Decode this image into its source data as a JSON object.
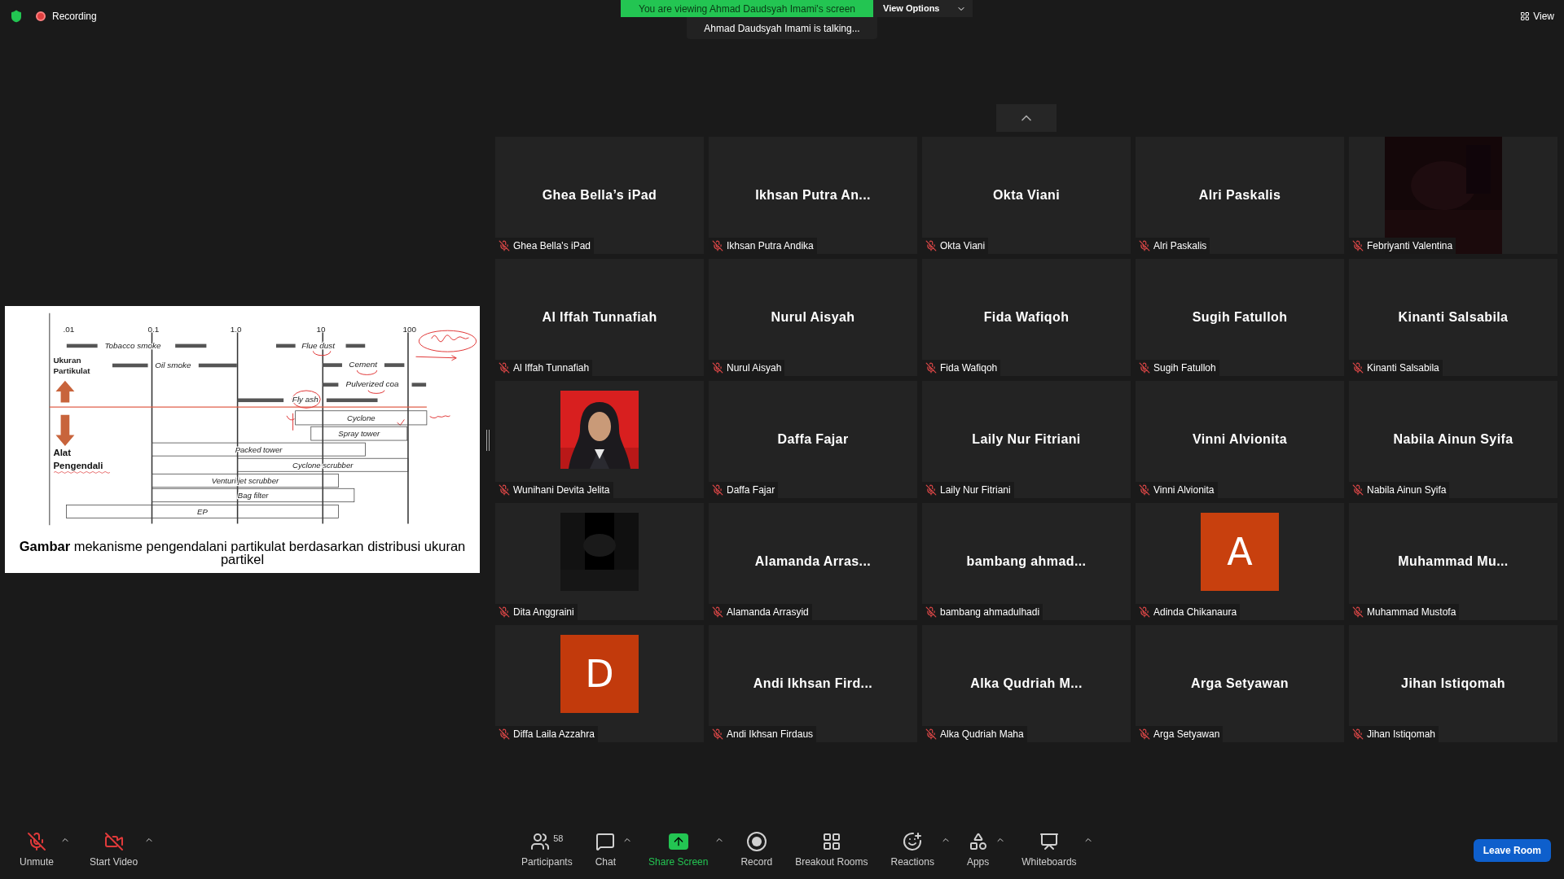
{
  "top_bar": {
    "recording": "Recording",
    "view": "View",
    "banner": "You are viewing Ahmad Daudsyah Imami's screen",
    "view_options": "View Options",
    "talking": "Ahmad Daudsyah Imami is talking..."
  },
  "slide": {
    "ticks": [
      ".01",
      "0.1",
      "1.0",
      "10",
      "100"
    ],
    "size_label": [
      "Ukuran",
      "Partikulat"
    ],
    "device_label": [
      "Alat",
      "Pengendali"
    ],
    "particles": [
      "Tobacco smoke",
      "Oil smoke",
      "Flue dust",
      "Cement",
      "Pulverized coa",
      "Fly ash"
    ],
    "devices": [
      "Cyclone",
      "Spray tower",
      "Packed tower",
      "Cyclone scrubber",
      "Venturi jet scrubber",
      "Bag filter",
      "EP"
    ],
    "caption": "**Gambar** mekanisme pengendalani partikulat berdasarkan distribusi ukuran partikel"
  },
  "tiles": [
    {
      "kind": "name",
      "display": "Ghea Bella’s iPad",
      "label": "Ghea Bella's iPad",
      "muted": true
    },
    {
      "kind": "name",
      "display": "Ikhsan Putra An...",
      "label": "Ikhsan Putra Andika",
      "muted": true
    },
    {
      "kind": "name",
      "display": "Okta Viani",
      "label": "Okta Viani",
      "muted": true
    },
    {
      "kind": "name",
      "display": "Alri Paskalis",
      "label": "Alri Paskalis",
      "muted": true
    },
    {
      "kind": "video",
      "label": "Febriyanti Valentina",
      "muted": true
    },
    {
      "kind": "name",
      "display": "Al Iffah Tunnafiah",
      "label": "Al Iffah Tunnafiah",
      "muted": true
    },
    {
      "kind": "name",
      "display": "Nurul Aisyah",
      "label": "Nurul Aisyah",
      "muted": true
    },
    {
      "kind": "name",
      "display": "Fida Wafiqoh",
      "label": "Fida Wafiqoh",
      "muted": true
    },
    {
      "kind": "name",
      "display": "Sugih Fatulloh",
      "label": "Sugih Fatulloh",
      "muted": true
    },
    {
      "kind": "name",
      "display": "Kinanti Salsabila",
      "label": "Kinanti Salsabila",
      "muted": true
    },
    {
      "label": "Wunihani Devita Jelita",
      "muted": true
    },
    {
      "kind": "name",
      "display": "Daffa Fajar",
      "label": "Daffa Fajar",
      "muted": true
    },
    {
      "kind": "name",
      "display": "Laily Nur Fitriani",
      "label": "Laily Nur Fitriani",
      "muted": true
    },
    {
      "kind": "name",
      "display": "Vinni Alvionita",
      "label": "Vinni Alvionita",
      "muted": true
    },
    {
      "kind": "name",
      "display": "Nabila Ainun Syifa",
      "label": "Nabila Ainun Syifa",
      "muted": true
    },
    {
      "kind": "camera",
      "label": "Dita Anggraini",
      "muted": true
    },
    {
      "kind": "name",
      "display": "Alamanda Arras...",
      "label": "Alamanda Arrasyid",
      "muted": true
    },
    {
      "kind": "name",
      "display": "bambang ahmad...",
      "label": "bambang ahmadulhadi",
      "muted": true
    },
    {
      "kind": "avatar",
      "letter": "A",
      "color": "#c8400e",
      "label": "Adinda Chikanaura",
      "muted": true
    },
    {
      "kind": "name",
      "display": "Muhammad Mu...",
      "label": "Muhammad Mustofa",
      "muted": true
    },
    {
      "kind": "avatar",
      "letter": "D",
      "color": "#c23a0c",
      "label": "Diffa Laila Azzahra",
      "muted": true
    },
    {
      "kind": "name",
      "display": "Andi Ikhsan Fird...",
      "label": "Andi Ikhsan Firdaus",
      "muted": true
    },
    {
      "kind": "name",
      "display": "Alka Qudriah M...",
      "label": "Alka Qudriah Maha",
      "muted": true
    },
    {
      "kind": "name",
      "display": "Arga Setyawan",
      "label": "Arga Setyawan",
      "muted": true
    },
    {
      "kind": "name",
      "display": "Jihan Istiqomah",
      "label": "Jihan Istiqomah",
      "muted": true
    }
  ],
  "toolbar": {
    "left": [
      {
        "kind": "mic",
        "label": "Unmute",
        "off": true,
        "caret": true
      },
      {
        "kind": "video",
        "label": "Start Video",
        "off": true,
        "caret": true
      }
    ],
    "center": [
      {
        "kind": "participants",
        "label": "Participants",
        "count": "58",
        "caret": false
      },
      {
        "kind": "chat",
        "label": "Chat",
        "caret": true
      },
      {
        "kind": "share",
        "label": "Share Screen",
        "caret": true
      },
      {
        "kind": "record",
        "label": "Record",
        "caret": false
      },
      {
        "kind": "breakout",
        "label": "Breakout Rooms",
        "caret": false
      },
      {
        "kind": "reactions",
        "label": "Reactions",
        "caret": true
      },
      {
        "kind": "apps",
        "label": "Apps",
        "caret": true
      },
      {
        "kind": "whiteboards",
        "label": "Whiteboards",
        "caret": true
      }
    ],
    "leave": "Leave Room"
  }
}
